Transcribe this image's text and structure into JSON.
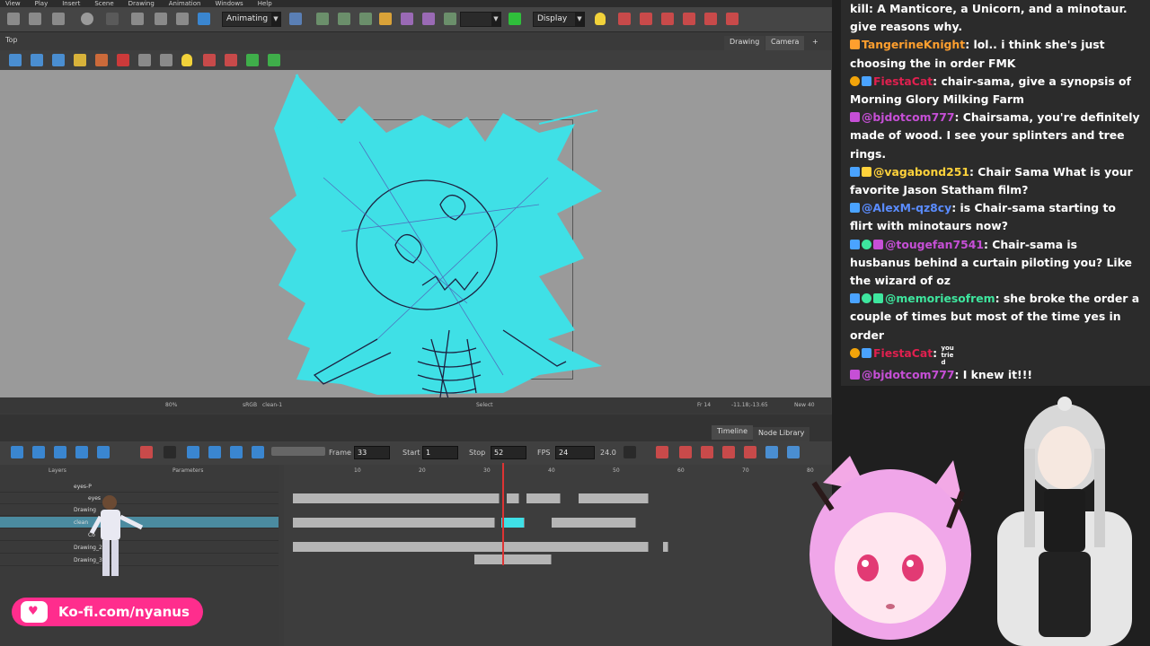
{
  "menubar": {
    "items": [
      "View",
      "Play",
      "Insert",
      "Scene",
      "Drawing",
      "Animation",
      "Windows",
      "Help"
    ]
  },
  "toolbar": {
    "mode_select": "Animating",
    "display_select": "Display"
  },
  "view_panel": {
    "label": "Top",
    "tabs": [
      "Drawing",
      "Camera"
    ]
  },
  "status_bar": {
    "zoom": "80%",
    "colorspace": "sRGB",
    "layer": "clean-1",
    "tool": "Select",
    "frame": "Fr 14",
    "coords": "-11.18;-13.65",
    "drawing_new": "New 40"
  },
  "timeline": {
    "tabs": [
      "Timeline",
      "Node Library"
    ],
    "frame_label": "Frame",
    "frame_value": "33",
    "start_label": "Start",
    "start_value": "1",
    "stop_label": "Stop",
    "stop_value": "52",
    "fps_label": "FPS",
    "fps_value": "24",
    "fps_readout": "24.0",
    "layers_header": "Layers",
    "params_header": "Parameters",
    "ruler": [
      "10",
      "20",
      "30",
      "40",
      "50",
      "60",
      "70",
      "80"
    ],
    "layers": [
      {
        "name": "eyes-P"
      },
      {
        "name": "eyes"
      },
      {
        "name": "Drawing"
      },
      {
        "name": "clean"
      },
      {
        "name": "Co"
      },
      {
        "name": "Drawing_2"
      },
      {
        "name": "Drawing_3"
      }
    ]
  },
  "chat": {
    "messages": [
      {
        "user": "",
        "text": "kill: A Manticore, a Unicorn, and a minotaur. give reasons why.",
        "color": "#ffffff"
      },
      {
        "user": "TangerineKnight",
        "text": "lol.. i think she's just choosing the in order FMK",
        "color": "#ff9f2e"
      },
      {
        "user": "FiestaCat",
        "text": "chair-sama, give a synopsis of Morning Glory Milking Farm",
        "color": "#e0204f"
      },
      {
        "user": "@bjdotcom777",
        "text": "Chairsama, you're definitely made of wood. I see your splinters and tree rings.",
        "color": "#c64fd6"
      },
      {
        "user": "@vagabond251",
        "text": "Chair Sama What is your favorite Jason Statham film?",
        "color": "#ffd23b"
      },
      {
        "user": "@AlexM-qz8cy",
        "text": "is Chair-sama starting to flirt with minotaurs now?",
        "color": "#5a8cff"
      },
      {
        "user": "@tougefan7541",
        "text": "Chair-sama is husbanus behind a curtain piloting you? Like the wizard of oz",
        "color": "#c64fd6"
      },
      {
        "user": "@memoriesofrem",
        "text": "she broke the order a couple of times but most of the time yes in order",
        "color": "#3ee69e"
      },
      {
        "user": "FiestaCat",
        "text": "you tried",
        "color": "#e0204f"
      },
      {
        "user": "@bjdotcom777",
        "text": "I knew it!!!",
        "color": "#c64fd6"
      }
    ]
  },
  "kofi": {
    "label": "Ko-fi.com/nyanus"
  },
  "colors": {
    "accent_cyan": "#3fe0e6",
    "kofi_pink": "#ff2d8d"
  }
}
